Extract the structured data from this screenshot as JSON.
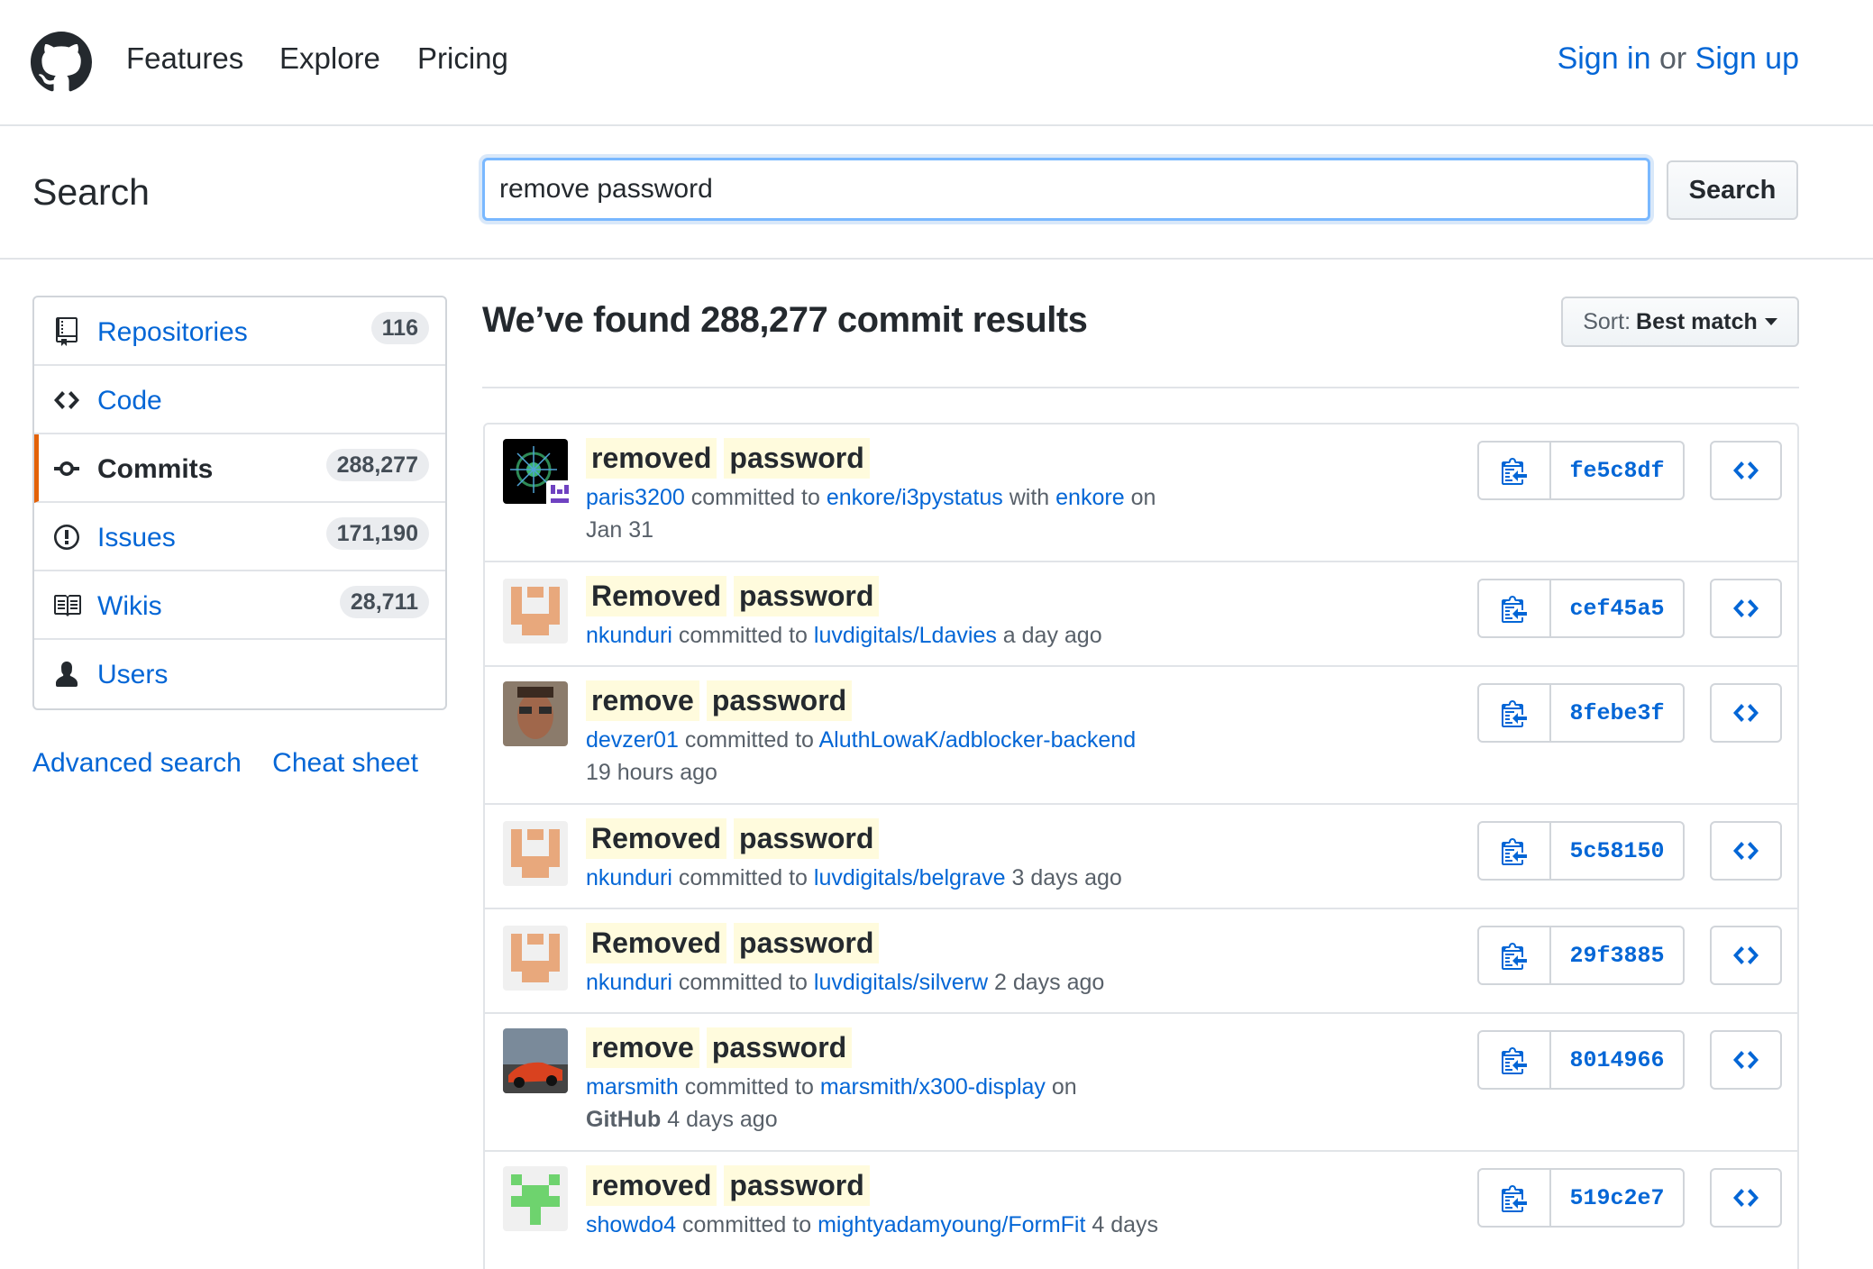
{
  "header": {
    "nav": [
      "Features",
      "Explore",
      "Pricing"
    ],
    "sign_in": "Sign in",
    "or": "or",
    "sign_up": "Sign up"
  },
  "search": {
    "title": "Search",
    "query": "remove password",
    "button": "Search"
  },
  "sidebar": {
    "items": [
      {
        "label": "Repositories",
        "count": "116",
        "icon": "repo-icon"
      },
      {
        "label": "Code",
        "count": "",
        "icon": "code-icon"
      },
      {
        "label": "Commits",
        "count": "288,277",
        "icon": "commit-icon",
        "selected": true
      },
      {
        "label": "Issues",
        "count": "171,190",
        "icon": "issue-icon"
      },
      {
        "label": "Wikis",
        "count": "28,711",
        "icon": "book-icon"
      },
      {
        "label": "Users",
        "count": "",
        "icon": "person-icon"
      }
    ],
    "advanced_search": "Advanced search",
    "cheat_sheet": "Cheat sheet"
  },
  "results": {
    "title": "We’ve found 288,277 commit results",
    "sort_label": "Sort:",
    "sort_value": "Best match"
  },
  "commits": [
    {
      "words": [
        "removed",
        "password"
      ],
      "author": "paris3200",
      "repo": "enkore/i3pystatus",
      "with_text": "with",
      "coauthor": "enkore",
      "on_text": "on",
      "date_line2": "Jan 31",
      "sha": "fe5c8df"
    },
    {
      "words": [
        "Removed",
        "password"
      ],
      "author": "nkunduri",
      "repo": "luvdigitals/Ldavies",
      "time": "a day ago",
      "sha": "cef45a5"
    },
    {
      "words": [
        "remove",
        "password"
      ],
      "author": "devzer01",
      "repo": "AluthLowaK/adblocker-backend",
      "date_line2": "19 hours ago",
      "sha": "8febe3f"
    },
    {
      "words": [
        "Removed",
        "password"
      ],
      "author": "nkunduri",
      "repo": "luvdigitals/belgrave",
      "time": "3 days ago",
      "sha": "5c58150"
    },
    {
      "words": [
        "Removed",
        "password"
      ],
      "author": "nkunduri",
      "repo": "luvdigitals/silverw",
      "time": "2 days ago",
      "sha": "29f3885"
    },
    {
      "words": [
        "remove",
        "password"
      ],
      "author": "marsmith",
      "repo": "marsmith/x300-display",
      "on_text": "on",
      "platform": "GitHub",
      "date_line2": "4 days ago",
      "sha": "8014966"
    },
    {
      "words": [
        "removed",
        "password"
      ],
      "author": "showdo4",
      "repo": "mightyadamyoung/FormFit",
      "time": "4 days",
      "sha": "519c2e7"
    }
  ],
  "common": {
    "committed_to": "committed to"
  }
}
